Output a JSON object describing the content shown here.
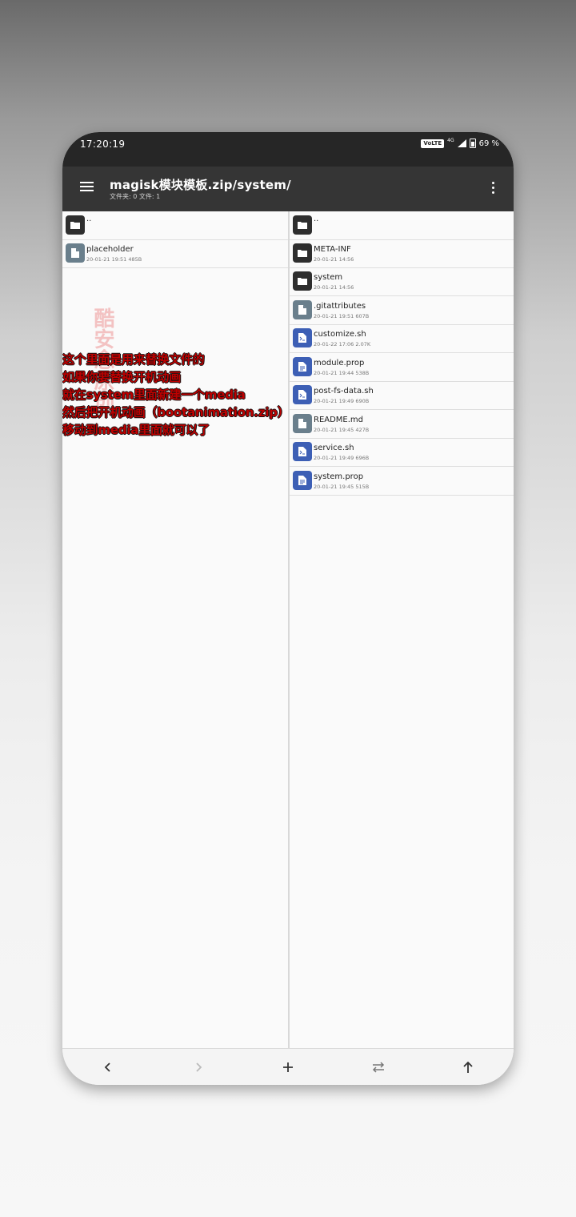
{
  "status_bar": {
    "time": "17:20:19",
    "network_badge": "VoLTE",
    "network_type": "4G",
    "battery": "69 %"
  },
  "app_bar": {
    "title": "magisk模块模板.zip/system/",
    "subtitle": "文件夹: 0   文件: 1",
    "menu_icon": "hamburger-menu-icon",
    "overflow_icon": "more-vert-icon"
  },
  "left_pane": {
    "items": [
      {
        "name": "..",
        "meta": "",
        "type": "folder"
      },
      {
        "name": "placeholder",
        "meta": "20-01-21 19:51  485B",
        "type": "file"
      }
    ]
  },
  "right_pane": {
    "items": [
      {
        "name": "..",
        "meta": "",
        "type": "folder"
      },
      {
        "name": "META-INF",
        "meta": "20-01-21 14:56",
        "type": "folder"
      },
      {
        "name": "system",
        "meta": "20-01-21 14:56",
        "type": "folder"
      },
      {
        "name": ".gitattributes",
        "meta": "20-01-21 19:51  607B",
        "type": "file"
      },
      {
        "name": "customize.sh",
        "meta": "20-01-22 17:06  2.07K",
        "type": "script"
      },
      {
        "name": "module.prop",
        "meta": "20-01-21 19:44  538B",
        "type": "doc"
      },
      {
        "name": "post-fs-data.sh",
        "meta": "20-01-21 19:49  690B",
        "type": "script"
      },
      {
        "name": "README.md",
        "meta": "20-01-21 19:45  427B",
        "type": "file"
      },
      {
        "name": "service.sh",
        "meta": "20-01-21 19:49  696B",
        "type": "script"
      },
      {
        "name": "system.prop",
        "meta": "20-01-21 19:45  515B",
        "type": "doc"
      }
    ]
  },
  "annotation": {
    "lines": [
      "这个里面是用来替换文件的",
      "如果你要替换开机动画",
      "就在system里面新建一个media",
      "然后把开机动画（bootanimation.zip）",
      "移动到media里面就可以了"
    ]
  },
  "watermark": "酷安念原创",
  "bottom_nav": {
    "items": [
      "back-arrow-icon",
      "forward-arrow-icon",
      "add-icon",
      "swap-icon",
      "up-arrow-icon"
    ]
  },
  "colors": {
    "app_bar": "#353535",
    "status_bar": "#262626",
    "annotation_text": "#c00000",
    "script_icon": "#3d5fb5",
    "generic_icon": "#6a7f8c"
  }
}
